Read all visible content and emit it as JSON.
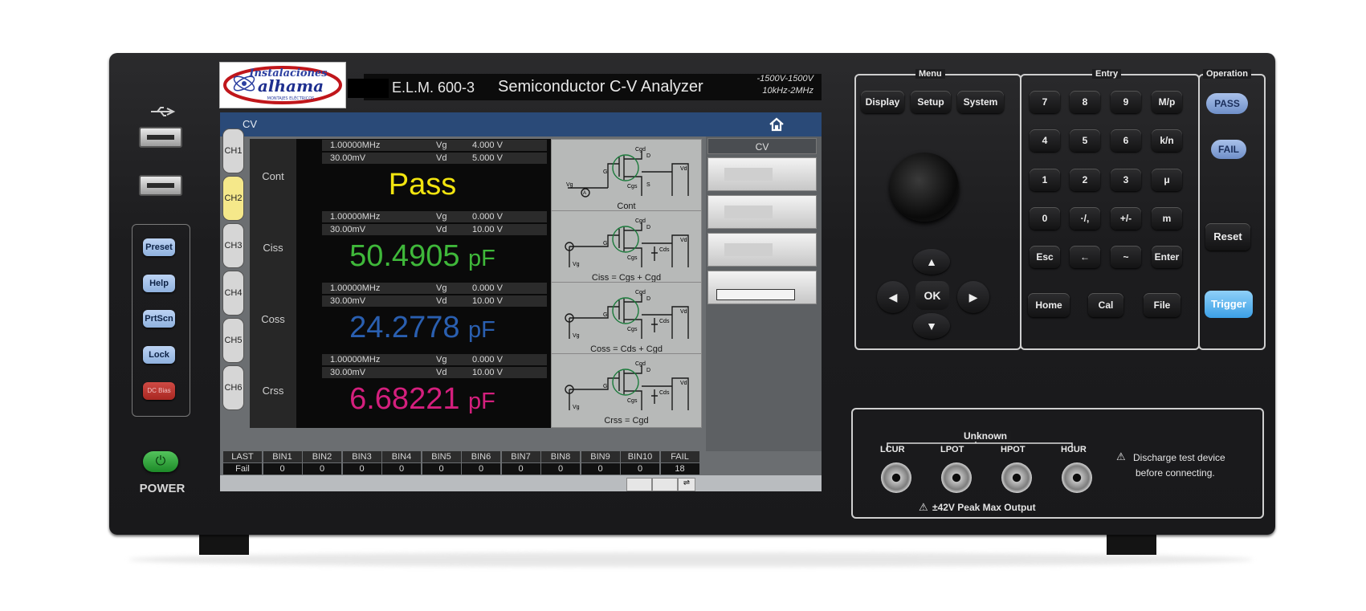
{
  "logo": {
    "line1": "Instalaciones",
    "line2": "alhama",
    "line3": "MONTAJES ELÉCTRICOS"
  },
  "header": {
    "model": "E.L.M. 600-3",
    "name": "Semiconductor C-V Analyzer",
    "spec_voltage": "-1500V-1500V",
    "spec_freq": "10kHz-2MHz"
  },
  "left_buttons": {
    "preset": "Preset",
    "help": "Help",
    "prtscn": "PrtScn",
    "lock": "Lock",
    "dcbias": "DC Bias"
  },
  "power_label": "POWER",
  "screen": {
    "title": "CV",
    "tabs": [
      "CH1",
      "CH2",
      "CH3",
      "CH4",
      "CH5",
      "CH6"
    ],
    "active_tab": "CH2",
    "side_title": "CV",
    "rows": [
      {
        "name": "Cont",
        "freq": "1.00000MHz",
        "level": "30.00mV",
        "p1": "Vg",
        "v1": "4.000 V",
        "p2": "Vd",
        "v2": "5.000 V",
        "value": "Pass",
        "unit": "",
        "color": "#f2e40f",
        "circuit_label": "Cont"
      },
      {
        "name": "Ciss",
        "freq": "1.00000MHz",
        "level": "30.00mV",
        "p1": "Vg",
        "v1": "0.000 V",
        "p2": "Vd",
        "v2": "10.00 V",
        "value": "50.4905",
        "unit": "pF",
        "color": "#3fb83a",
        "circuit_label": "Ciss = Cgs + Cgd"
      },
      {
        "name": "Coss",
        "freq": "1.00000MHz",
        "level": "30.00mV",
        "p1": "Vg",
        "v1": "0.000 V",
        "p2": "Vd",
        "v2": "10.00 V",
        "value": "24.2778",
        "unit": "pF",
        "color": "#2a5fb0",
        "circuit_label": "Coss = Cds + Cgd"
      },
      {
        "name": "Crss",
        "freq": "1.00000MHz",
        "level": "30.00mV",
        "p1": "Vg",
        "v1": "0.000 V",
        "p2": "Vd",
        "v2": "10.00 V",
        "value": "6.68221",
        "unit": "pF",
        "color": "#d41f7d",
        "circuit_label": "Crss = Cgd"
      }
    ],
    "bins": {
      "headers": [
        "LAST",
        "BIN1",
        "BIN2",
        "BIN3",
        "BIN4",
        "BIN5",
        "BIN6",
        "BIN7",
        "BIN8",
        "BIN9",
        "BIN10",
        "FAIL"
      ],
      "values": [
        "Fail",
        "0",
        "0",
        "0",
        "0",
        "0",
        "0",
        "0",
        "0",
        "0",
        "0",
        "18"
      ]
    }
  },
  "panel": {
    "menu_label": "Menu",
    "entry_label": "Entry",
    "operation_label": "Operation",
    "menu_buttons": [
      "Display",
      "Setup",
      "System"
    ],
    "entry_keys": [
      [
        "7",
        "8",
        "9",
        "M/p"
      ],
      [
        "4",
        "5",
        "6",
        "k/n"
      ],
      [
        "1",
        "2",
        "3",
        "μ"
      ],
      [
        "0",
        "·/,",
        "+/-",
        "m"
      ],
      [
        "Esc",
        "←",
        "~",
        "Enter"
      ]
    ],
    "entry_bottom": [
      "Home",
      "Cal",
      "File"
    ],
    "nav": {
      "ok": "OK",
      "up": "▲",
      "down": "▼",
      "left": "◀",
      "right": "▶"
    },
    "operation": {
      "pass": "PASS",
      "fail": "FAIL",
      "reset": "Reset",
      "trigger": "Trigger"
    }
  },
  "terminals": {
    "title": "Unknown",
    "labels": [
      "LCUR",
      "LPOT",
      "HPOT",
      "HCUR"
    ],
    "warning_line1": "Discharge test device",
    "warning_line2": "before connecting.",
    "peak": "±42V Peak Max Output"
  }
}
